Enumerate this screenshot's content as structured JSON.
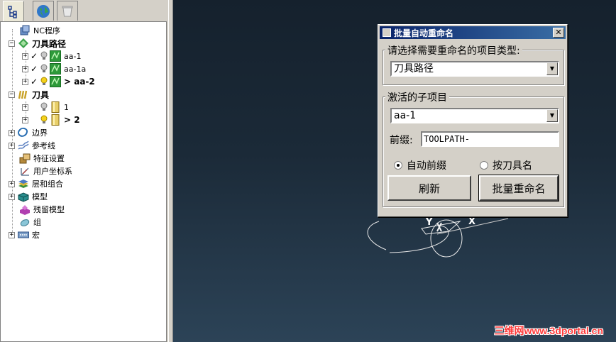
{
  "explorer": {
    "tabs": [
      {
        "icon": "tree-icon",
        "active": true
      },
      {
        "icon": "globe-icon",
        "active": false
      },
      {
        "icon": "bin-icon",
        "active": false
      }
    ],
    "tree": {
      "nc_programs": "NC程序",
      "toolpaths": "刀具路径",
      "toolpath_items": [
        "aa-1",
        "aa-1a",
        "> aa-2"
      ],
      "tools": "刀具",
      "tool_items": [
        "1",
        "> 2"
      ],
      "boundaries": "边界",
      "pattern": "参考线",
      "feature_sets": "特征设置",
      "workplanes": "用户坐标系",
      "levels": "层和组合",
      "models": "模型",
      "stock_models": "残留模型",
      "groups": "组",
      "macros": "宏"
    }
  },
  "dialog": {
    "title": "批量自动重命名",
    "close": "✕",
    "type_group_label": "请选择需要重命名的项目类型:",
    "type_value": "刀具路径",
    "active_group_label": "激活的子项目",
    "active_value": "aa-1",
    "prefix_label": "前缀:",
    "prefix_value": "TOOLPATH-",
    "radio_auto": "自动前缀",
    "radio_tool": "按刀具名",
    "refresh_button": "刷新",
    "rename_button": "批量重命名"
  },
  "viewport": {
    "axis_y": "Y",
    "axis_x": "X",
    "watermark": "三维网www.3dportal.cn"
  },
  "colors": {
    "toolpath_green": "#2e9a3a",
    "tool_gold": "#d6b13a",
    "title_blue": "#0a246a"
  }
}
